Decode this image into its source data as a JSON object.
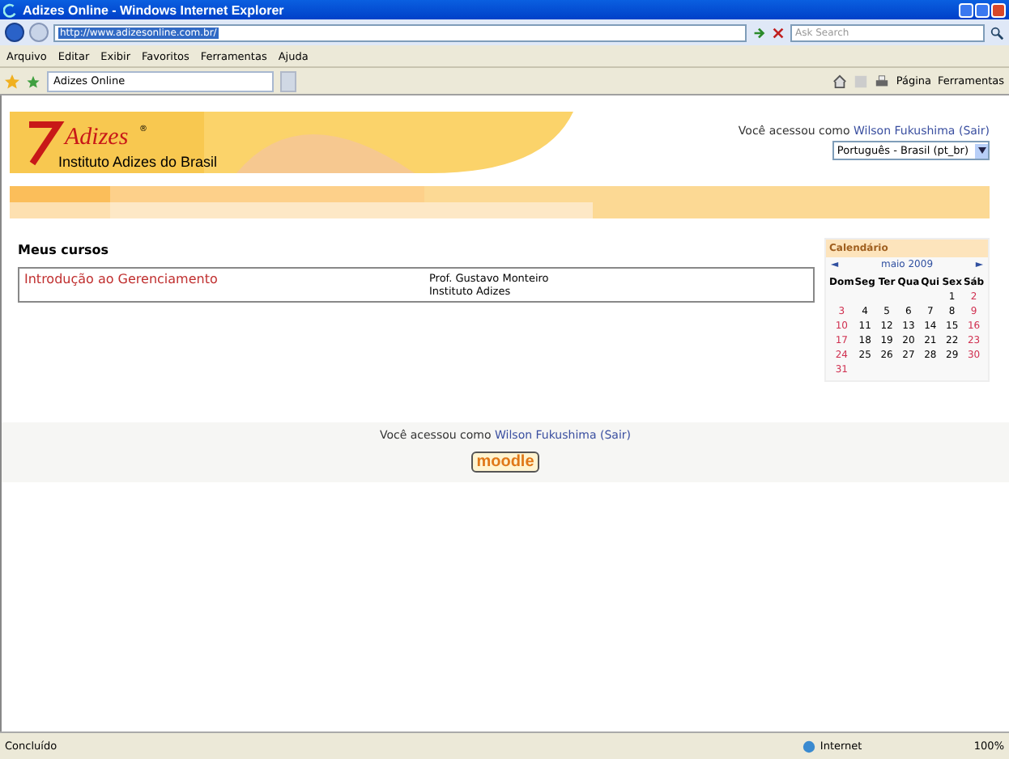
{
  "window": {
    "title": "Adizes Online - Windows Internet Explorer"
  },
  "address_bar": {
    "url": "http://www.adizesonline.com.br/"
  },
  "search": {
    "placeholder": "Ask Search"
  },
  "menu": [
    "Arquivo",
    "Editar",
    "Exibir",
    "Favoritos",
    "Ferramentas",
    "Ajuda"
  ],
  "tabs": [
    {
      "label": "Adizes Online",
      "selected": true
    }
  ],
  "toolbar": [
    "Página",
    "Ferramentas"
  ],
  "page": {
    "header": {
      "logo_text": "Adizes",
      "logo_mark": "®",
      "subtitle": "Instituto Adizes do Brasil",
      "login_prefix": "Você acessou como",
      "user": "Wilson Fukushima",
      "logout": "(Sair)",
      "language": "Português - Brasil (pt_br)"
    },
    "courses": {
      "title": "Meus cursos",
      "items": [
        {
          "name": "Introdução ao Gerenciamento",
          "teacher": "Prof. Gustavo Monteiro",
          "institution": "Instituto Adizes"
        }
      ]
    },
    "calendar": {
      "title": "Calendário",
      "prev": "◄",
      "month": "maio 2009",
      "next": "►",
      "weekdays": [
        "Dom",
        "Seg",
        "Ter",
        "Qua",
        "Qui",
        "Sex",
        "Sáb"
      ],
      "weeks": [
        [
          "1",
          "2"
        ],
        [
          "3",
          "4",
          "5",
          "6",
          "7",
          "8",
          "9"
        ],
        [
          "10",
          "11",
          "12",
          "13",
          "14",
          "15",
          "16"
        ],
        [
          "17",
          "18",
          "19",
          "20",
          "21",
          "22",
          "23"
        ],
        [
          "24",
          "25",
          "26",
          "27",
          "28",
          "29",
          "30"
        ],
        [
          "31"
        ]
      ]
    },
    "footer": {
      "login_prefix": "Você acessou como",
      "user": "Wilson Fukushima",
      "logout": "(Sair)",
      "logo_text": "moodle"
    }
  },
  "status_bar": {
    "status": "Concluído",
    "zone": "Internet",
    "zoom": "100%"
  }
}
